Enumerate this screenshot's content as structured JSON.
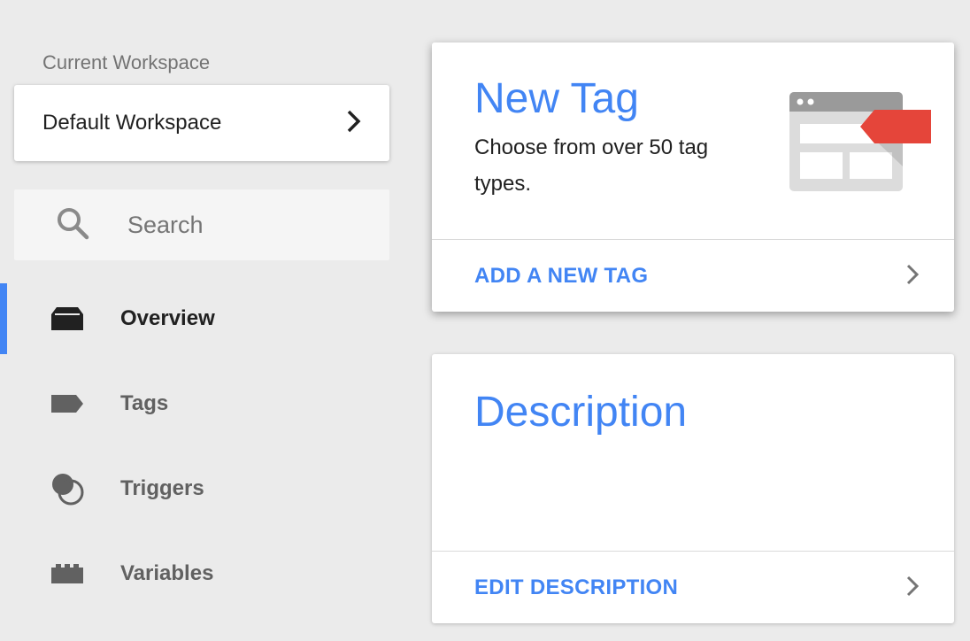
{
  "sidebar": {
    "workspace_label": "Current Workspace",
    "workspace_name": "Default Workspace",
    "search_placeholder": "Search",
    "items": [
      {
        "label": "Overview",
        "icon": "overview-icon",
        "active": true
      },
      {
        "label": "Tags",
        "icon": "tag-icon",
        "active": false
      },
      {
        "label": "Triggers",
        "icon": "triggers-icon",
        "active": false
      },
      {
        "label": "Variables",
        "icon": "variables-icon",
        "active": false
      }
    ]
  },
  "cards": {
    "new_tag": {
      "title": "New Tag",
      "description": "Choose from over 50 tag types.",
      "action": "ADD A NEW TAG"
    },
    "description": {
      "title": "Description",
      "action": "EDIT DESCRIPTION"
    }
  },
  "colors": {
    "accent": "#4285f4",
    "tag_red": "#e5453a",
    "background": "#ebebeb"
  }
}
